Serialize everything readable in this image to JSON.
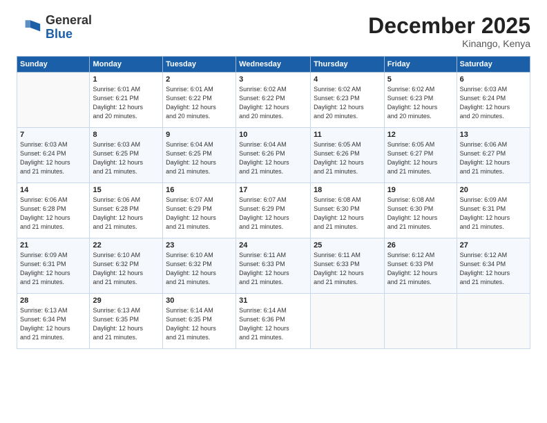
{
  "logo": {
    "general": "General",
    "blue": "Blue"
  },
  "header": {
    "month": "December 2025",
    "location": "Kinango, Kenya"
  },
  "weekdays": [
    "Sunday",
    "Monday",
    "Tuesday",
    "Wednesday",
    "Thursday",
    "Friday",
    "Saturday"
  ],
  "weeks": [
    [
      {
        "day": "",
        "info": ""
      },
      {
        "day": "1",
        "info": "Sunrise: 6:01 AM\nSunset: 6:21 PM\nDaylight: 12 hours\nand 20 minutes."
      },
      {
        "day": "2",
        "info": "Sunrise: 6:01 AM\nSunset: 6:22 PM\nDaylight: 12 hours\nand 20 minutes."
      },
      {
        "day": "3",
        "info": "Sunrise: 6:02 AM\nSunset: 6:22 PM\nDaylight: 12 hours\nand 20 minutes."
      },
      {
        "day": "4",
        "info": "Sunrise: 6:02 AM\nSunset: 6:23 PM\nDaylight: 12 hours\nand 20 minutes."
      },
      {
        "day": "5",
        "info": "Sunrise: 6:02 AM\nSunset: 6:23 PM\nDaylight: 12 hours\nand 20 minutes."
      },
      {
        "day": "6",
        "info": "Sunrise: 6:03 AM\nSunset: 6:24 PM\nDaylight: 12 hours\nand 20 minutes."
      }
    ],
    [
      {
        "day": "7",
        "info": "Sunrise: 6:03 AM\nSunset: 6:24 PM\nDaylight: 12 hours\nand 21 minutes."
      },
      {
        "day": "8",
        "info": "Sunrise: 6:03 AM\nSunset: 6:25 PM\nDaylight: 12 hours\nand 21 minutes."
      },
      {
        "day": "9",
        "info": "Sunrise: 6:04 AM\nSunset: 6:25 PM\nDaylight: 12 hours\nand 21 minutes."
      },
      {
        "day": "10",
        "info": "Sunrise: 6:04 AM\nSunset: 6:26 PM\nDaylight: 12 hours\nand 21 minutes."
      },
      {
        "day": "11",
        "info": "Sunrise: 6:05 AM\nSunset: 6:26 PM\nDaylight: 12 hours\nand 21 minutes."
      },
      {
        "day": "12",
        "info": "Sunrise: 6:05 AM\nSunset: 6:27 PM\nDaylight: 12 hours\nand 21 minutes."
      },
      {
        "day": "13",
        "info": "Sunrise: 6:06 AM\nSunset: 6:27 PM\nDaylight: 12 hours\nand 21 minutes."
      }
    ],
    [
      {
        "day": "14",
        "info": "Sunrise: 6:06 AM\nSunset: 6:28 PM\nDaylight: 12 hours\nand 21 minutes."
      },
      {
        "day": "15",
        "info": "Sunrise: 6:06 AM\nSunset: 6:28 PM\nDaylight: 12 hours\nand 21 minutes."
      },
      {
        "day": "16",
        "info": "Sunrise: 6:07 AM\nSunset: 6:29 PM\nDaylight: 12 hours\nand 21 minutes."
      },
      {
        "day": "17",
        "info": "Sunrise: 6:07 AM\nSunset: 6:29 PM\nDaylight: 12 hours\nand 21 minutes."
      },
      {
        "day": "18",
        "info": "Sunrise: 6:08 AM\nSunset: 6:30 PM\nDaylight: 12 hours\nand 21 minutes."
      },
      {
        "day": "19",
        "info": "Sunrise: 6:08 AM\nSunset: 6:30 PM\nDaylight: 12 hours\nand 21 minutes."
      },
      {
        "day": "20",
        "info": "Sunrise: 6:09 AM\nSunset: 6:31 PM\nDaylight: 12 hours\nand 21 minutes."
      }
    ],
    [
      {
        "day": "21",
        "info": "Sunrise: 6:09 AM\nSunset: 6:31 PM\nDaylight: 12 hours\nand 21 minutes."
      },
      {
        "day": "22",
        "info": "Sunrise: 6:10 AM\nSunset: 6:32 PM\nDaylight: 12 hours\nand 21 minutes."
      },
      {
        "day": "23",
        "info": "Sunrise: 6:10 AM\nSunset: 6:32 PM\nDaylight: 12 hours\nand 21 minutes."
      },
      {
        "day": "24",
        "info": "Sunrise: 6:11 AM\nSunset: 6:33 PM\nDaylight: 12 hours\nand 21 minutes."
      },
      {
        "day": "25",
        "info": "Sunrise: 6:11 AM\nSunset: 6:33 PM\nDaylight: 12 hours\nand 21 minutes."
      },
      {
        "day": "26",
        "info": "Sunrise: 6:12 AM\nSunset: 6:33 PM\nDaylight: 12 hours\nand 21 minutes."
      },
      {
        "day": "27",
        "info": "Sunrise: 6:12 AM\nSunset: 6:34 PM\nDaylight: 12 hours\nand 21 minutes."
      }
    ],
    [
      {
        "day": "28",
        "info": "Sunrise: 6:13 AM\nSunset: 6:34 PM\nDaylight: 12 hours\nand 21 minutes."
      },
      {
        "day": "29",
        "info": "Sunrise: 6:13 AM\nSunset: 6:35 PM\nDaylight: 12 hours\nand 21 minutes."
      },
      {
        "day": "30",
        "info": "Sunrise: 6:14 AM\nSunset: 6:35 PM\nDaylight: 12 hours\nand 21 minutes."
      },
      {
        "day": "31",
        "info": "Sunrise: 6:14 AM\nSunset: 6:36 PM\nDaylight: 12 hours\nand 21 minutes."
      },
      {
        "day": "",
        "info": ""
      },
      {
        "day": "",
        "info": ""
      },
      {
        "day": "",
        "info": ""
      }
    ]
  ]
}
